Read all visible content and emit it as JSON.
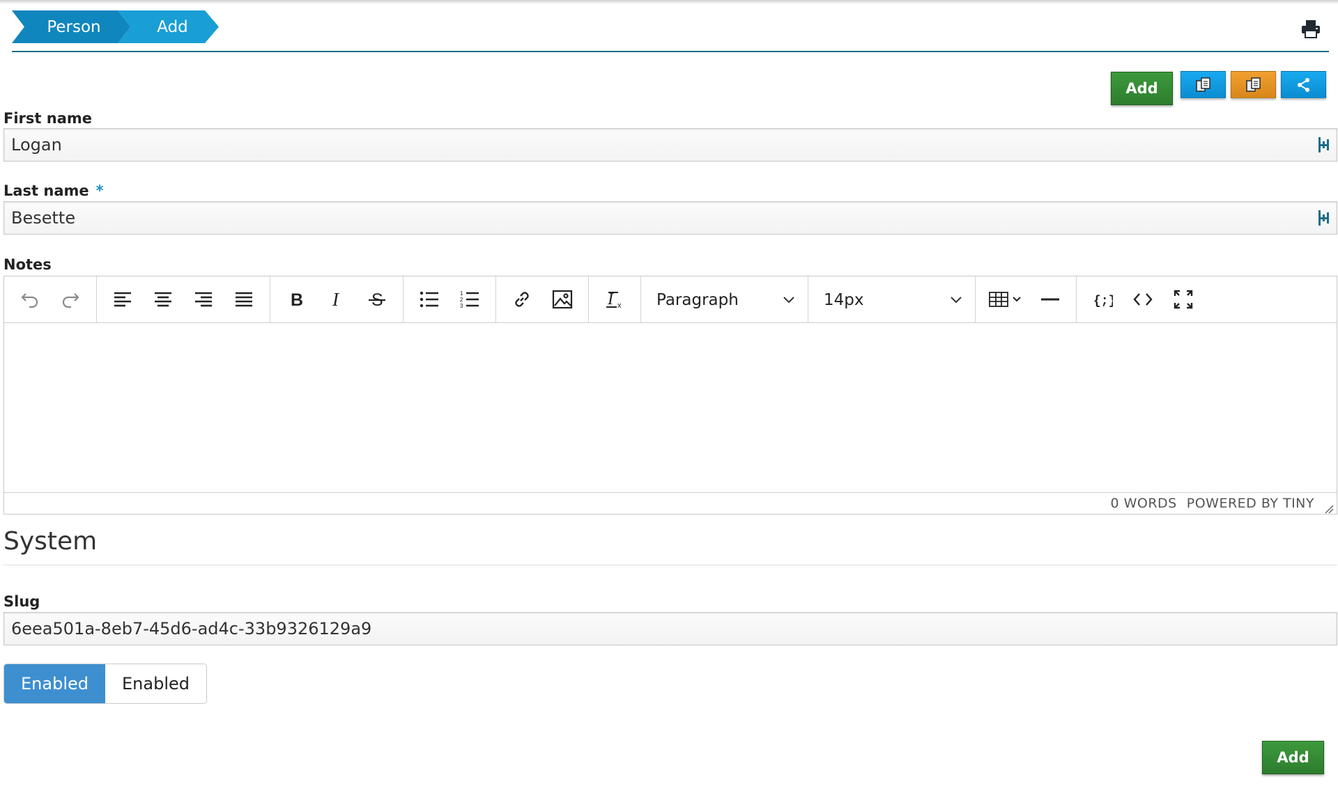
{
  "breadcrumb": {
    "items": [
      "Person",
      "Add"
    ]
  },
  "toolbar": {
    "add_label": "Add",
    "print_icon": "printer-icon",
    "copy_icon": "clipboard-copy-icon",
    "share_icon": "share-icon",
    "colors": {
      "add": "#2d7d2d",
      "blue": "#0b8cd0",
      "orange": "#d8861a"
    }
  },
  "form": {
    "first_name": {
      "label": "First name",
      "value": "Logan"
    },
    "last_name": {
      "label": "Last name",
      "required_mark": "*",
      "value": "Besette"
    },
    "notes": {
      "label": "Notes",
      "block_format": "Paragraph",
      "font_size": "14px",
      "word_count": "0 WORDS",
      "powered_by": "POWERED BY TINY"
    }
  },
  "system": {
    "title": "System",
    "slug": {
      "label": "Slug",
      "value": "6eea501a-8eb7-45d6-ad4c-33b9326129a9"
    },
    "toggle": {
      "on_label": "Enabled",
      "off_label": "Enabled"
    }
  },
  "footer": {
    "add_label": "Add"
  }
}
